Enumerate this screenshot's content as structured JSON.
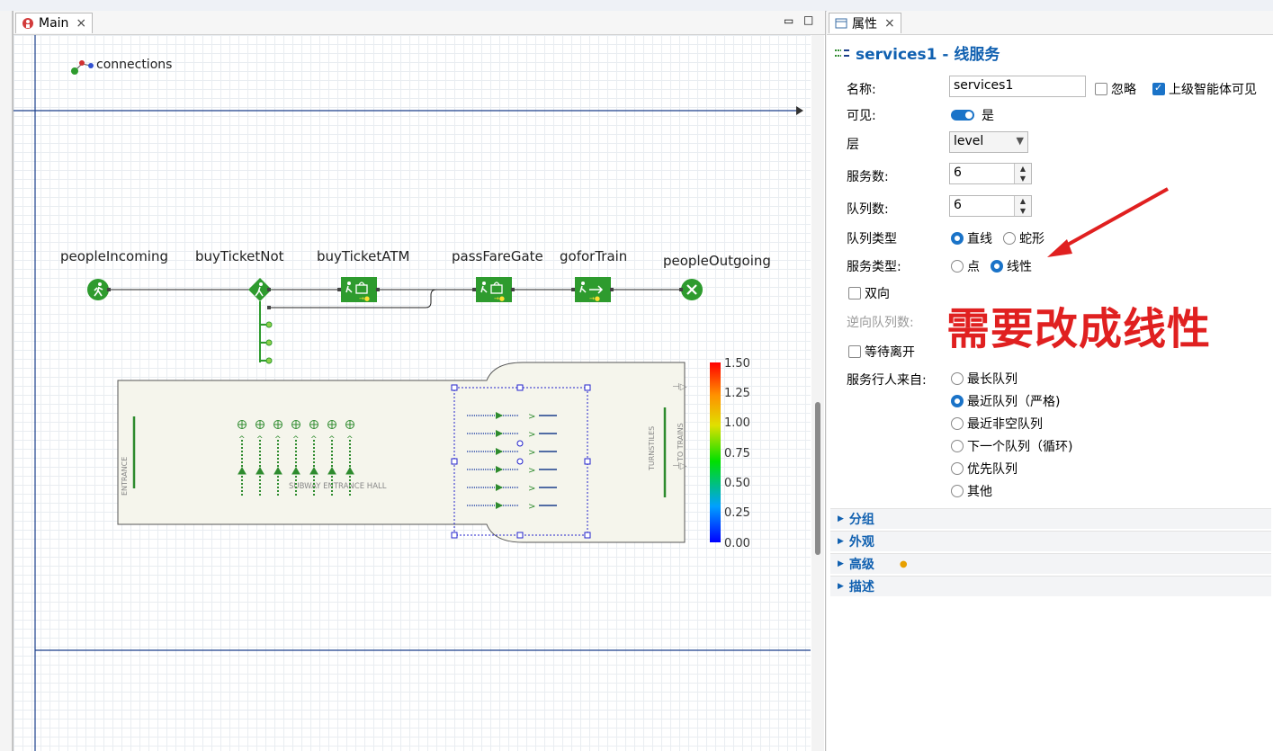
{
  "editor": {
    "tab_label": "Main",
    "close_glyph": "×",
    "min_glyph": "▭",
    "max_glyph": "□"
  },
  "canvas": {
    "connections_label": "connections",
    "blocks": [
      {
        "name": "peopleIncoming"
      },
      {
        "name": "buyTicketNot"
      },
      {
        "name": "buyTicketATM"
      },
      {
        "name": "passFareGate"
      },
      {
        "name": "goforTrain"
      },
      {
        "name": "peopleOutgoing"
      }
    ],
    "layout": {
      "entrance_label": "ENTRANCE",
      "hall_label": "SUBWAY ENTRANCE HALL",
      "turnstiles_label": "TURNSTILES",
      "to_trains_label": "TO TRAINS"
    },
    "legend": {
      "ticks": [
        "1.50",
        "1.25",
        "1.00",
        "0.75",
        "0.50",
        "0.25",
        "0.00"
      ],
      "colors": [
        "#0000ff",
        "#00a0ff",
        "#00e000",
        "#e0e000",
        "#ff9000",
        "#ff0000"
      ]
    }
  },
  "props": {
    "tab_label": "属性",
    "close_glyph": "×",
    "title": "services1 - 线服务",
    "name_label": "名称:",
    "name_value": "services1",
    "ignore_label": "忽略",
    "ignore_checked": false,
    "visible_upper_label": "上级智能体可见",
    "visible_upper_checked": true,
    "visible_label": "可见:",
    "visible_value": "是",
    "layer_label": "层",
    "layer_value": "level",
    "services_count_label": "服务数:",
    "services_count_value": "6",
    "queues_count_label": "队列数:",
    "queues_count_value": "6",
    "queue_type_label": "队列类型",
    "queue_type_options": [
      "直线",
      "蛇形"
    ],
    "queue_type_selected": "直线",
    "service_type_label": "服务类型:",
    "service_type_options": [
      "点",
      "线性"
    ],
    "service_type_selected": "线性",
    "bidirectional_label": "双向",
    "reverse_queue_label": "逆向队列数:",
    "wait_leave_label": "等待离开",
    "serve_from_label": "服务行人来自:",
    "serve_from_options": [
      "最长队列",
      "最近队列（严格)",
      "最近非空队列",
      "下一个队列（循环)",
      "优先队列",
      "其他"
    ],
    "serve_from_selected": "最近队列（严格)",
    "sections": [
      "分组",
      "外观",
      "高级",
      "描述"
    ]
  },
  "annotation": {
    "text": "需要改成线性",
    "color": "#e02020"
  }
}
